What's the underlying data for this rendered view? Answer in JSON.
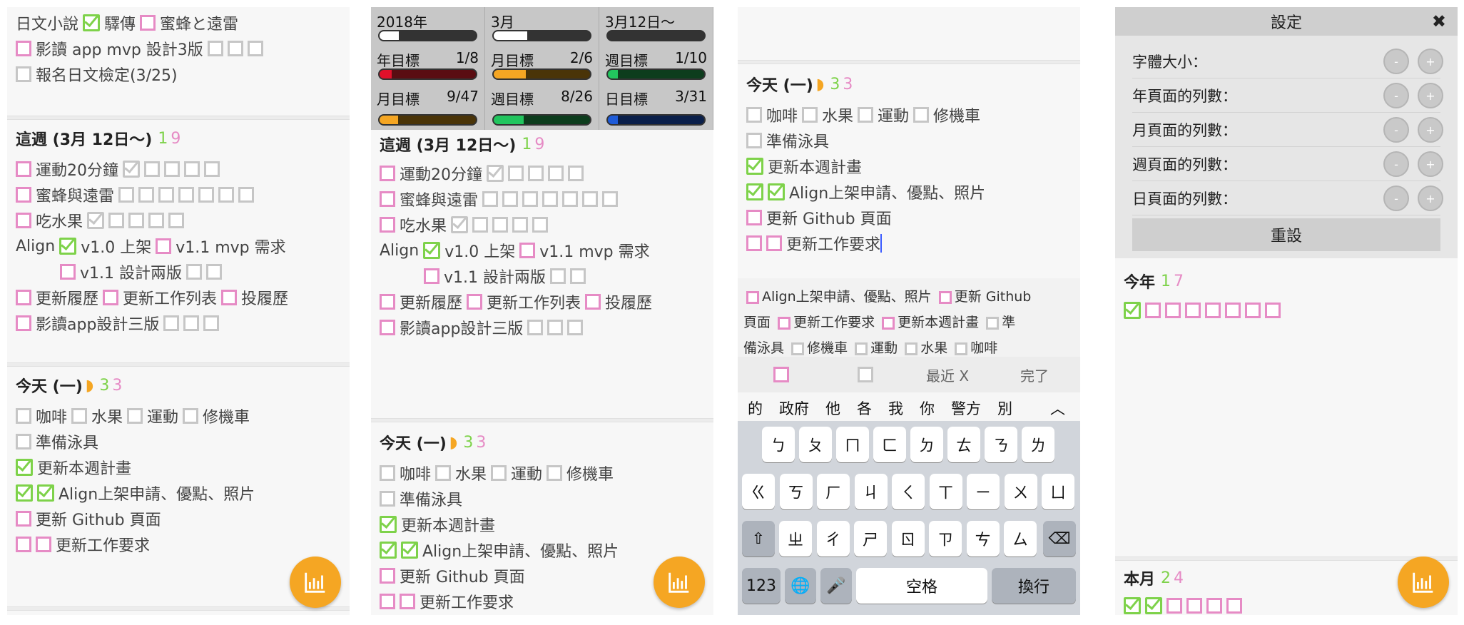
{
  "colors": {
    "pink": "#e68bc5",
    "green": "#7ed24a",
    "gray": "#c6c6c6",
    "fab": "#f5a623"
  },
  "p1": {
    "top1": {
      "a": "日文小說",
      "b": "驛傳",
      "c": "蜜蜂と遠雷"
    },
    "top2": "影讀 app mvp 設計3版",
    "top3": "報名日文檢定(3/25)",
    "week": {
      "title": "這週 (3月 12日～)",
      "n1": "1",
      "n2": "9",
      "r1": "運動20分鐘",
      "r2": "蜜蜂與遠雷",
      "r3": "吃水果",
      "r4a": "Align",
      "r4b": "v1.0 上架",
      "r4c": "v1.1 mvp 需求",
      "r5": "v1.1 設計兩版",
      "r6a": "更新履歷",
      "r6b": "更新工作列表",
      "r6c": "投履歷",
      "r7": "影讀app設計三版"
    },
    "today": {
      "title": "今天 (一)",
      "n1": "3",
      "n2": "3",
      "a": "咖啡",
      "b": "水果",
      "c": "運動",
      "d": "修機車",
      "e": "準備泳具",
      "f": "更新本週計畫",
      "g": "Align上架申請、優點、照片",
      "h": "更新 Github 頁面",
      "i": "更新工作要求"
    }
  },
  "p2": {
    "stats": [
      {
        "label": "2018年",
        "value": "",
        "progress": 0.2,
        "color": "#ffffff"
      },
      {
        "label": "3月",
        "value": "",
        "progress": 0.35,
        "color": "#ffffff"
      },
      {
        "label": "3月12日～",
        "value": "",
        "progress": 0,
        "color": "#ffffff"
      },
      {
        "label": "年目標",
        "value": "1/8",
        "progress": 0.125,
        "color": "#e0102a",
        "track": "#5a0d12"
      },
      {
        "label": "月目標",
        "value": "2/6",
        "progress": 0.33,
        "color": "#f5a623",
        "track": "#4a3408"
      },
      {
        "label": "週目標",
        "value": "1/10",
        "progress": 0.1,
        "color": "#22c55e",
        "track": "#0d3d1d"
      },
      {
        "label": "月目標",
        "value": "9/47",
        "progress": 0.19,
        "color": "#f5a623",
        "track": "#4a3408"
      },
      {
        "label": "週目標",
        "value": "8/26",
        "progress": 0.31,
        "color": "#22c55e",
        "track": "#0d3d1d"
      },
      {
        "label": "日目標",
        "value": "3/31",
        "progress": 0.1,
        "color": "#1e5bd8",
        "track": "#0a1f4a"
      }
    ]
  },
  "p3": {
    "palette": {
      "a": "Align上架申請、優點、照片",
      "b": "更新 Github",
      "c": "頁面",
      "d": "更新工作要求",
      "e": "更新本週計畫",
      "f": "準",
      "g": "備泳具",
      "h": "修機車",
      "i": "運動",
      "j": "水果",
      "k": "咖啡"
    },
    "cbar": {
      "recent": "最近 X",
      "done": "完了"
    },
    "suggest": [
      "的",
      "政府",
      "他",
      "各",
      "我",
      "你",
      "警方",
      "別"
    ],
    "keys": {
      "r1": [
        "ㄅ",
        "ㄆ",
        "ㄇ",
        "ㄈ",
        "ㄉ",
        "ㄊ",
        "ㄋ",
        "ㄌ"
      ],
      "r2": [
        "ㄍ",
        "ㄎ",
        "ㄏ",
        "ㄐ",
        "ㄑ",
        "ㄒ",
        "ㄧ",
        "ㄨ",
        "ㄩ"
      ],
      "r3": [
        "ㄓ",
        "ㄔ",
        "ㄕ",
        "ㄖ",
        "ㄗ",
        "ㄘ",
        "ㄙ"
      ],
      "num": "123",
      "space": "空格",
      "ret": "換行",
      "shift": "⇧",
      "del": "⌫",
      "globe": "🌐",
      "mic": "🎤",
      "up": "︿"
    }
  },
  "p4": {
    "title": "設定",
    "close": "✖",
    "rows": [
      "字體大小：",
      "年頁面的列數：",
      "月頁面的列數：",
      "週頁面的列數：",
      "日頁面的列數："
    ],
    "minus": "-",
    "plus": "+",
    "reset": "重設",
    "year": {
      "title": "今年",
      "n1": "1",
      "n2": "7"
    },
    "month": {
      "title": "本月",
      "n1": "2",
      "n2": "4"
    }
  }
}
